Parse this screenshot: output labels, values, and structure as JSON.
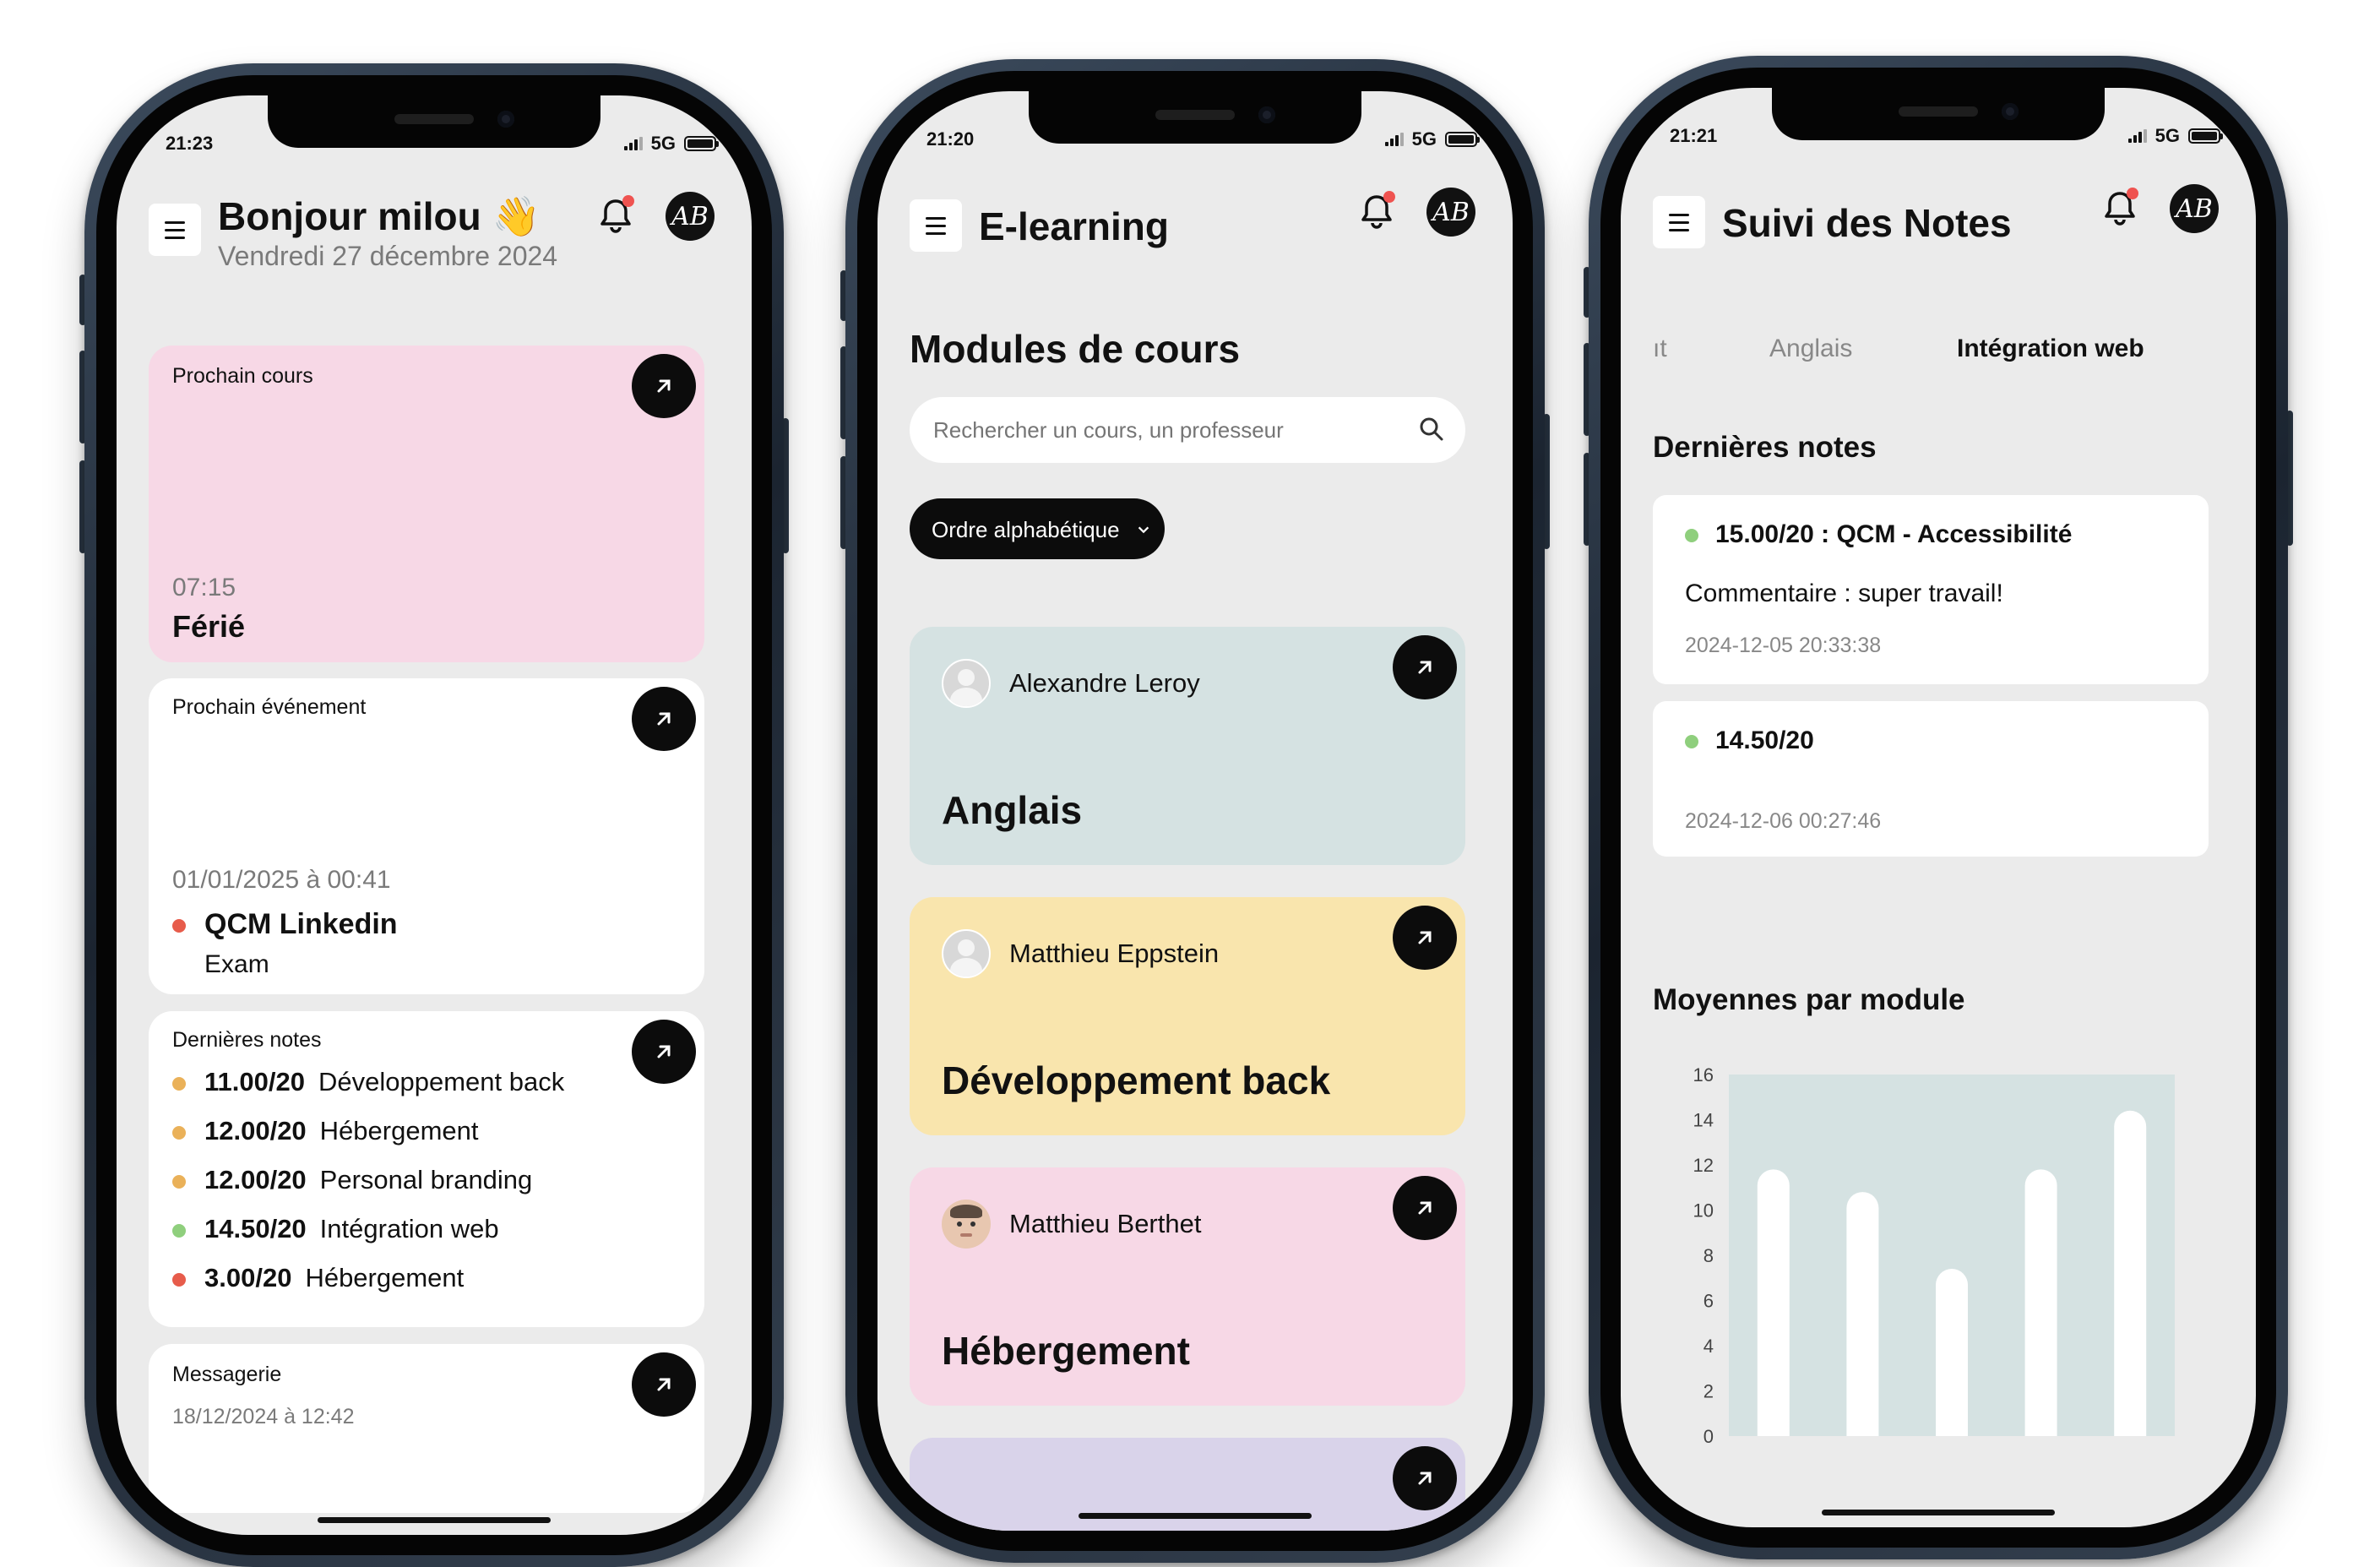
{
  "colors": {
    "pink_card": "#f7d8e6",
    "white_card": "#ffffff",
    "blue_card": "#d5e2e2",
    "yellow_card": "#f9e5ad",
    "screen_bg": "#ebebeb",
    "orange_dot": "#eab159",
    "green_dot": "#8fcf7d",
    "red_dot": "#e75c4b",
    "chart_bg": "#d5e2e2"
  },
  "phone1": {
    "time": "21:23",
    "network": "5G",
    "greeting": "Bonjour milou 👋",
    "date": "Vendredi 27 décembre 2024",
    "avatar_initials": "AB",
    "next_course": {
      "label": "Prochain cours",
      "time": "07:15",
      "name": "Férié"
    },
    "next_event": {
      "label": "Prochain événement",
      "datetime": "01/01/2025 à 00:41",
      "name": "QCM Linkedin",
      "type": "Exam"
    },
    "last_grades": {
      "label": "Dernières notes",
      "items": [
        {
          "grade": "11.00/20",
          "module": "Développement back",
          "status": "orange"
        },
        {
          "grade": "12.00/20",
          "module": "Hébergement",
          "status": "orange"
        },
        {
          "grade": "12.00/20",
          "module": "Personal branding",
          "status": "orange"
        },
        {
          "grade": "14.50/20",
          "module": "Intégration web",
          "status": "green"
        },
        {
          "grade": "3.00/20",
          "module": "Hébergement",
          "status": "red"
        }
      ]
    },
    "messages": {
      "label": "Messagerie",
      "datetime": "18/12/2024 à 12:42"
    }
  },
  "phone2": {
    "time": "21:20",
    "network": "5G",
    "title": "E-learning",
    "avatar_initials": "AB",
    "section_title": "Modules de cours",
    "search_placeholder": "Rechercher un cours, un professeur",
    "sort_label": "Ordre alphabétique",
    "modules": [
      {
        "teacher": "Alexandre Leroy",
        "name": "Anglais",
        "color": "#d5e2e2",
        "avatar": "default"
      },
      {
        "teacher": "Matthieu Eppstein",
        "name": "Développement back",
        "color": "#f9e5ad",
        "avatar": "default"
      },
      {
        "teacher": "Matthieu Berthet",
        "name": "Hébergement",
        "color": "#f7d8e6",
        "avatar": "photo"
      }
    ]
  },
  "phone3": {
    "time": "21:21",
    "network": "5G",
    "title": "Suivi des Notes",
    "avatar_initials": "AB",
    "tabs": [
      {
        "label": "ıt",
        "active": false
      },
      {
        "label": "Anglais",
        "active": false
      },
      {
        "label": "Intégration web",
        "active": true
      }
    ],
    "last_notes_title": "Dernières notes",
    "notes": [
      {
        "grade": "15.00/20 : QCM - Accessibilité",
        "comment": "Commentaire : super travail!",
        "datetime": "2024-12-05 20:33:38"
      },
      {
        "grade": "14.50/20",
        "comment": "",
        "datetime": "2024-12-06 00:27:46"
      }
    ],
    "averages_title": "Moyennes par module"
  },
  "chart_data": {
    "type": "bar",
    "title": "Moyennes par module",
    "categories": [
      "",
      "",
      "",
      "",
      ""
    ],
    "values": [
      11.8,
      10.8,
      7.4,
      11.8,
      14.4
    ],
    "ylim": [
      0,
      16
    ],
    "yticks": [
      "16",
      "14",
      "12",
      "10",
      "8",
      "6",
      "4",
      "2",
      "0"
    ],
    "grid": false
  }
}
